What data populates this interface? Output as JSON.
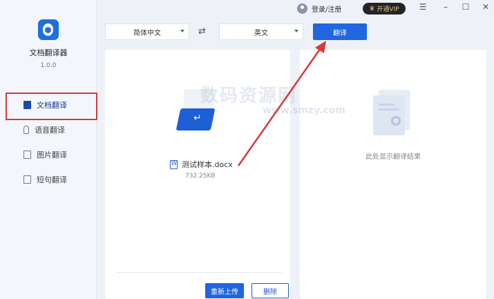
{
  "app": {
    "name": "文档翻译器",
    "version": "1.0.0"
  },
  "sidebar": {
    "items": [
      {
        "label": "文档翻译",
        "icon": "document-icon",
        "active": true
      },
      {
        "label": "语音翻译",
        "icon": "microphone-icon",
        "active": false
      },
      {
        "label": "图片翻译",
        "icon": "image-icon",
        "active": false
      },
      {
        "label": "短句翻译",
        "icon": "sentence-icon",
        "active": false
      }
    ]
  },
  "topbar": {
    "login_label": "登录/注册",
    "vip_label": "开通VIP",
    "window_controls": [
      "menu-icon",
      "minimize-icon",
      "maximize-icon",
      "close-icon"
    ]
  },
  "language": {
    "source": "简体中文",
    "target": "英文",
    "swap_icon": "swap-icon",
    "translate_label": "翻译"
  },
  "source_panel": {
    "file_name": "测试样本.docx",
    "file_size": "732.25KB",
    "reupload_label": "重新上传",
    "delete_label": "删除"
  },
  "result_panel": {
    "hint": "此处显示翻译结果"
  },
  "watermark": {
    "text": "数码资源网",
    "sub": "www.smzy.com"
  },
  "colors": {
    "accent": "#1f66e0",
    "highlight": "#d6393a",
    "vip_bg": "#23232b",
    "vip_text": "#e8c675"
  }
}
